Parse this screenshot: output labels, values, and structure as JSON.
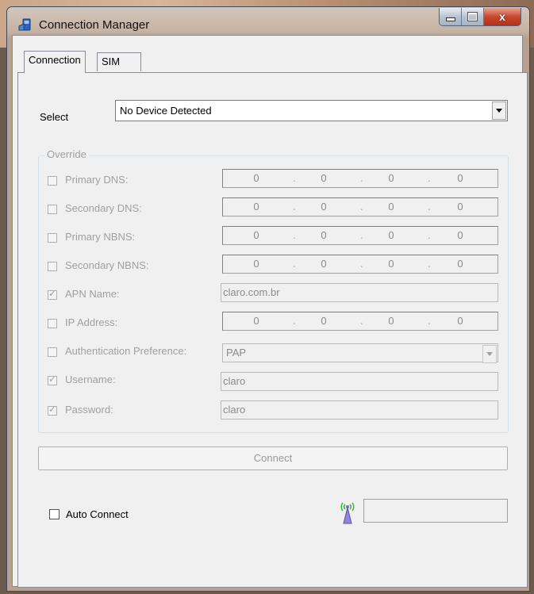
{
  "window": {
    "title": "Connection Manager",
    "close_glyph": "x"
  },
  "tabs": [
    {
      "label": "Connection",
      "active": true
    },
    {
      "label": "SIM",
      "active": false
    }
  ],
  "device": {
    "select_label": "Select",
    "selected_value": "No Device Detected"
  },
  "override": {
    "legend": "Override",
    "rows": [
      {
        "label": "Primary DNS:",
        "checked": false,
        "type": "ip",
        "octets": [
          "0",
          "0",
          "0",
          "0"
        ]
      },
      {
        "label": "Secondary DNS:",
        "checked": false,
        "type": "ip",
        "octets": [
          "0",
          "0",
          "0",
          "0"
        ]
      },
      {
        "label": "Primary NBNS:",
        "checked": false,
        "type": "ip",
        "octets": [
          "0",
          "0",
          "0",
          "0"
        ]
      },
      {
        "label": "Secondary NBNS:",
        "checked": false,
        "type": "ip",
        "octets": [
          "0",
          "0",
          "0",
          "0"
        ]
      },
      {
        "label": "APN Name:",
        "checked": true,
        "type": "text",
        "value": "claro.com.br"
      },
      {
        "label": "IP Address:",
        "checked": false,
        "type": "ip",
        "octets": [
          "0",
          "0",
          "0",
          "0"
        ]
      },
      {
        "label": "Authentication Preference:",
        "checked": false,
        "type": "select",
        "value": "PAP"
      },
      {
        "label": "Username:",
        "checked": true,
        "type": "text",
        "value": "claro"
      },
      {
        "label": "Password:",
        "checked": true,
        "type": "text",
        "value": "claro"
      }
    ]
  },
  "connect_button": "Connect",
  "auto_connect": {
    "label": "Auto Connect",
    "checked": false
  },
  "icons": {
    "app": "connection-manager-icon",
    "signal": "antenna-signal-icon"
  },
  "colors": {
    "window_bg": "#f0f0f0",
    "disabled_text": "#a0a0a0",
    "close_button": "#c7482f"
  }
}
